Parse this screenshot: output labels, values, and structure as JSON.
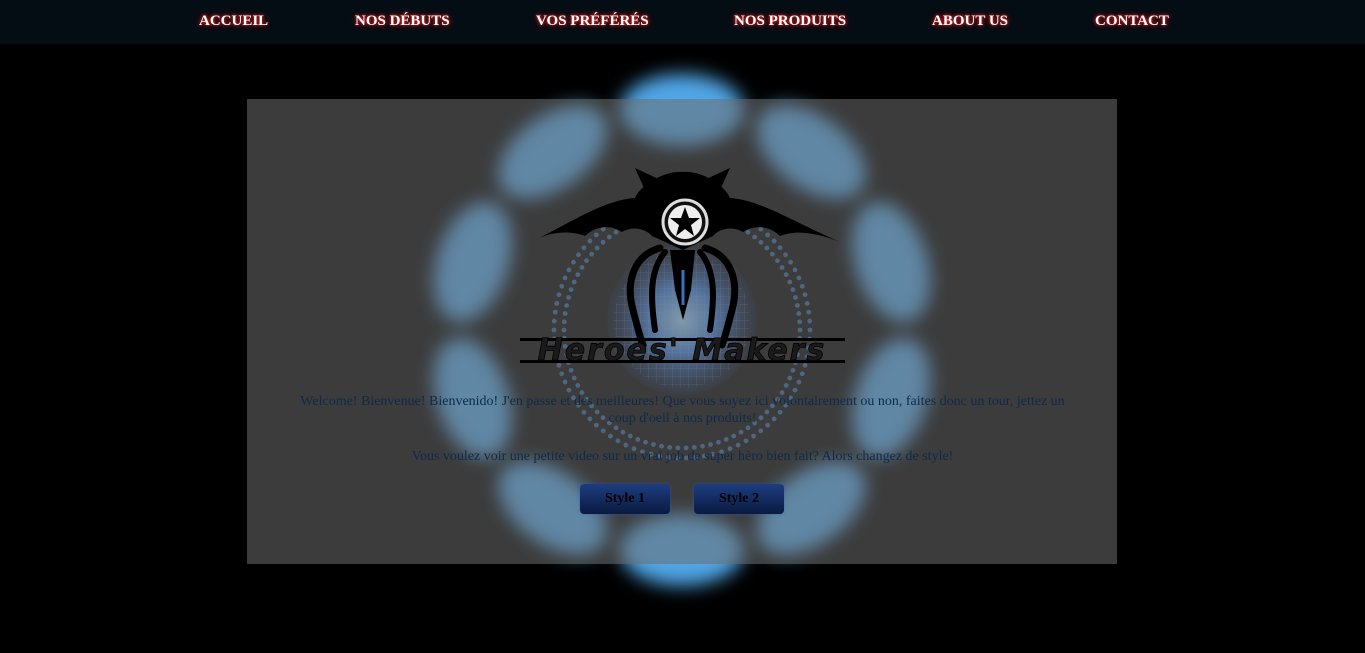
{
  "nav": {
    "items": [
      {
        "label": "ACCUEIL"
      },
      {
        "label": "NOS DÉBUTS"
      },
      {
        "label": "VOS PRÉFÉRÉS"
      },
      {
        "label": "NOS PRODUITS"
      },
      {
        "label": "ABOUT US"
      },
      {
        "label": "CONTACT"
      }
    ]
  },
  "hero": {
    "logo_text": "Heroes' Makers",
    "welcome_text": "Welcome! Bienvenue! Bienvenido! J'en passe et des meilleures! Que vous soyez ici volontairement ou non, faites donc un tour, jettez un coup d'oeil à nos produits!",
    "video_text": "Vous voulez voir une petite video sur un vrai job de super hèro bien fait? Alors changez de style!",
    "buttons": {
      "style1": "Style 1",
      "style2": "Style 2"
    }
  },
  "colors": {
    "background": "#000000",
    "nav_bg": "#050d14",
    "nav_text_glow": "#ff3030",
    "reactor_glow": "#4aa8ff",
    "text": "#0d2a4a"
  },
  "icons": [
    "arc-reactor-graphic",
    "bat-spider-logo",
    "star-emblem-icon"
  ]
}
